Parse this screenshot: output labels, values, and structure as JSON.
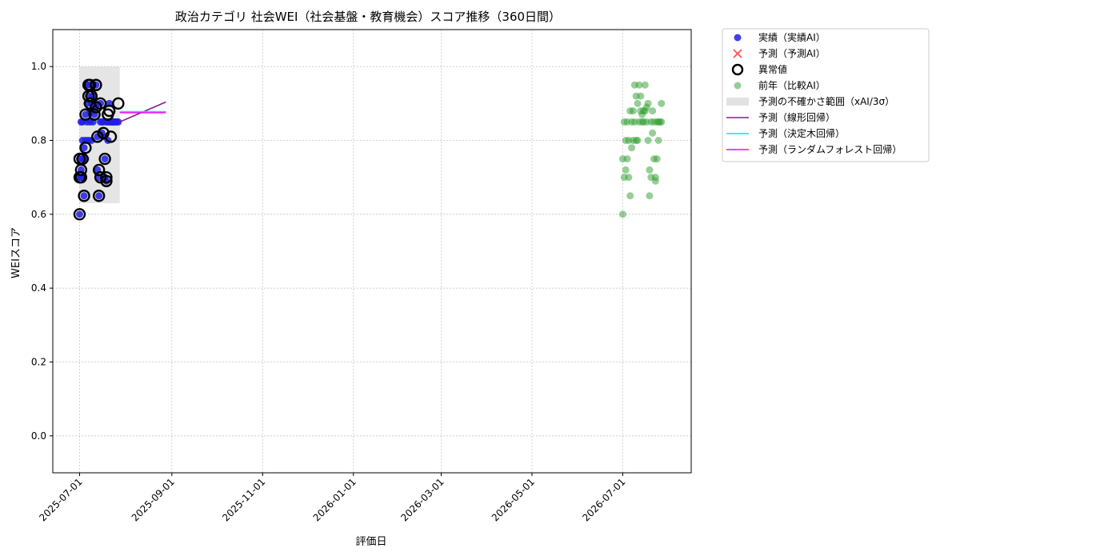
{
  "chart_data": {
    "type": "scatter",
    "title": "政治カテゴリ 社会WEI（社会基盤・教育機会）スコア推移（360日間）",
    "xlabel": "評価日",
    "ylabel": "WEIスコア",
    "xlim": [
      "2025-06-13",
      "2026-08-16"
    ],
    "ylim": [
      -0.1,
      1.1
    ],
    "y_ticks": [
      0.0,
      0.2,
      0.4,
      0.6,
      0.8,
      1.0
    ],
    "y_tick_labels": [
      "0.0",
      "0.2",
      "0.4",
      "0.6",
      "0.8",
      "1.0"
    ],
    "x_ticks": [
      "2025-07-01",
      "2025-09-01",
      "2025-11-01",
      "2026-01-01",
      "2026-03-01",
      "2026-05-01",
      "2026-07-01"
    ],
    "grid": true,
    "legend_position": "outside-right-top",
    "colors": {
      "actual": "#1f1fe6",
      "forecast": "#ff3030",
      "anomaly": "#000000",
      "previous": "#2e9e2e",
      "band": "#bfbfbf",
      "linear": "#8b1a8b",
      "tree": "#00e5ff",
      "forest": "#ff00ff"
    },
    "legend": [
      {
        "key": "actual",
        "label": "実績（実績AI）",
        "marker": "dot"
      },
      {
        "key": "forecast",
        "label": "予測（予測AI）",
        "marker": "x"
      },
      {
        "key": "anomaly",
        "label": "異常値",
        "marker": "ring"
      },
      {
        "key": "previous",
        "label": "前年（比較AI）",
        "marker": "dot-faded"
      },
      {
        "key": "band",
        "label": "予測の不確かさ範囲（xAI/3σ）",
        "marker": "patch"
      },
      {
        "key": "linear",
        "label": "予測（線形回帰）",
        "marker": "line"
      },
      {
        "key": "tree",
        "label": "予測（決定木回帰）",
        "marker": "line"
      },
      {
        "key": "forest",
        "label": "予測（ランダムフォレスト回帰）",
        "marker": "line"
      }
    ],
    "uncertainty_band": {
      "x": [
        "2025-07-01",
        "2025-07-28"
      ],
      "y": [
        0.63,
        1.0
      ]
    },
    "series": [
      {
        "key": "actual",
        "x": [
          "2025-07-01",
          "2025-07-01",
          "2025-07-01",
          "2025-07-02",
          "2025-07-02",
          "2025-07-02",
          "2025-07-03",
          "2025-07-03",
          "2025-07-03",
          "2025-07-04",
          "2025-07-04",
          "2025-07-05",
          "2025-07-05",
          "2025-07-05",
          "2025-07-06",
          "2025-07-06",
          "2025-07-06",
          "2025-07-07",
          "2025-07-07",
          "2025-07-08",
          "2025-07-08",
          "2025-07-08",
          "2025-07-09",
          "2025-07-09",
          "2025-07-10",
          "2025-07-10",
          "2025-07-10",
          "2025-07-11",
          "2025-07-11",
          "2025-07-12",
          "2025-07-12",
          "2025-07-13",
          "2025-07-13",
          "2025-07-14",
          "2025-07-14",
          "2025-07-15",
          "2025-07-15",
          "2025-07-16",
          "2025-07-16",
          "2025-07-17",
          "2025-07-17",
          "2025-07-18",
          "2025-07-18",
          "2025-07-19",
          "2025-07-19",
          "2025-07-20",
          "2025-07-20",
          "2025-07-21",
          "2025-07-21",
          "2025-07-22",
          "2025-07-22",
          "2025-07-23",
          "2025-07-23",
          "2025-07-24",
          "2025-07-24",
          "2025-07-25",
          "2025-07-26",
          "2025-07-27"
        ],
        "y": [
          0.6,
          0.7,
          0.75,
          0.72,
          0.85,
          0.7,
          0.75,
          0.8,
          0.85,
          0.65,
          0.78,
          0.87,
          0.8,
          0.75,
          0.95,
          0.85,
          0.9,
          0.92,
          0.8,
          0.95,
          0.85,
          0.88,
          0.9,
          0.8,
          0.92,
          0.85,
          0.88,
          0.87,
          0.9,
          0.95,
          0.89,
          0.81,
          0.72,
          0.65,
          0.7,
          0.9,
          0.85,
          0.82,
          0.85,
          0.81,
          0.85,
          0.75,
          0.7,
          0.69,
          0.85,
          0.85,
          0.8,
          0.9,
          0.85,
          0.85,
          0.85,
          0.85,
          0.85,
          0.85,
          0.85,
          0.85,
          0.85,
          0.85
        ]
      },
      {
        "key": "anomaly",
        "x": [
          "2025-07-01",
          "2025-07-01",
          "2025-07-01",
          "2025-07-02",
          "2025-07-02",
          "2025-07-03",
          "2025-07-04",
          "2025-07-05",
          "2025-07-05",
          "2025-07-07",
          "2025-07-07",
          "2025-07-08",
          "2025-07-08",
          "2025-07-09",
          "2025-07-11",
          "2025-07-12",
          "2025-07-12",
          "2025-07-13",
          "2025-07-14",
          "2025-07-14",
          "2025-07-15",
          "2025-07-15",
          "2025-07-17",
          "2025-07-18",
          "2025-07-19",
          "2025-07-19",
          "2025-07-20",
          "2025-07-21",
          "2025-07-22",
          "2025-07-27"
        ],
        "y": [
          0.6,
          0.7,
          0.75,
          0.72,
          0.7,
          0.75,
          0.65,
          0.78,
          0.87,
          0.95,
          0.92,
          0.95,
          0.9,
          0.92,
          0.87,
          0.95,
          0.89,
          0.81,
          0.65,
          0.72,
          0.7,
          0.9,
          0.82,
          0.75,
          0.7,
          0.69,
          0.87,
          0.88,
          0.81,
          0.9
        ]
      },
      {
        "key": "previous",
        "x": [
          "2026-07-01",
          "2026-07-01",
          "2026-07-02",
          "2026-07-02",
          "2026-07-03",
          "2026-07-03",
          "2026-07-04",
          "2026-07-04",
          "2026-07-05",
          "2026-07-05",
          "2026-07-06",
          "2026-07-06",
          "2026-07-07",
          "2026-07-07",
          "2026-07-08",
          "2026-07-08",
          "2026-07-09",
          "2026-07-09",
          "2026-07-10",
          "2026-07-10",
          "2026-07-11",
          "2026-07-11",
          "2026-07-12",
          "2026-07-12",
          "2026-07-13",
          "2026-07-13",
          "2026-07-14",
          "2026-07-14",
          "2026-07-15",
          "2026-07-15",
          "2026-07-16",
          "2026-07-16",
          "2026-07-17",
          "2026-07-17",
          "2026-07-18",
          "2026-07-18",
          "2026-07-19",
          "2026-07-19",
          "2026-07-20",
          "2026-07-20",
          "2026-07-21",
          "2026-07-21",
          "2026-07-22",
          "2026-07-22",
          "2026-07-23",
          "2026-07-23",
          "2026-07-24",
          "2026-07-24",
          "2026-07-25",
          "2026-07-25",
          "2026-07-26",
          "2026-07-27",
          "2026-07-27"
        ],
        "y": [
          0.6,
          0.75,
          0.7,
          0.85,
          0.72,
          0.8,
          0.75,
          0.85,
          0.7,
          0.8,
          0.65,
          0.88,
          0.78,
          0.85,
          0.8,
          0.88,
          0.95,
          0.85,
          0.8,
          0.92,
          0.9,
          0.8,
          0.95,
          0.85,
          0.88,
          0.92,
          0.87,
          0.85,
          0.88,
          0.85,
          0.95,
          0.88,
          0.85,
          0.89,
          0.8,
          0.9,
          0.72,
          0.65,
          0.7,
          0.85,
          0.82,
          0.88,
          0.85,
          0.75,
          0.69,
          0.7,
          0.75,
          0.85,
          0.85,
          0.8,
          0.85,
          0.9,
          0.85
        ]
      }
    ],
    "forecast_lines": [
      {
        "key": "linear",
        "x": [
          "2025-07-28",
          "2025-08-28"
        ],
        "y": [
          0.85,
          0.904
        ]
      },
      {
        "key": "tree",
        "x": [
          "2025-07-28",
          "2025-08-28"
        ],
        "y": [
          0.878,
          0.878
        ]
      },
      {
        "key": "forest",
        "x": [
          "2025-07-28",
          "2025-08-28"
        ],
        "y": [
          0.875,
          0.875
        ]
      }
    ]
  }
}
